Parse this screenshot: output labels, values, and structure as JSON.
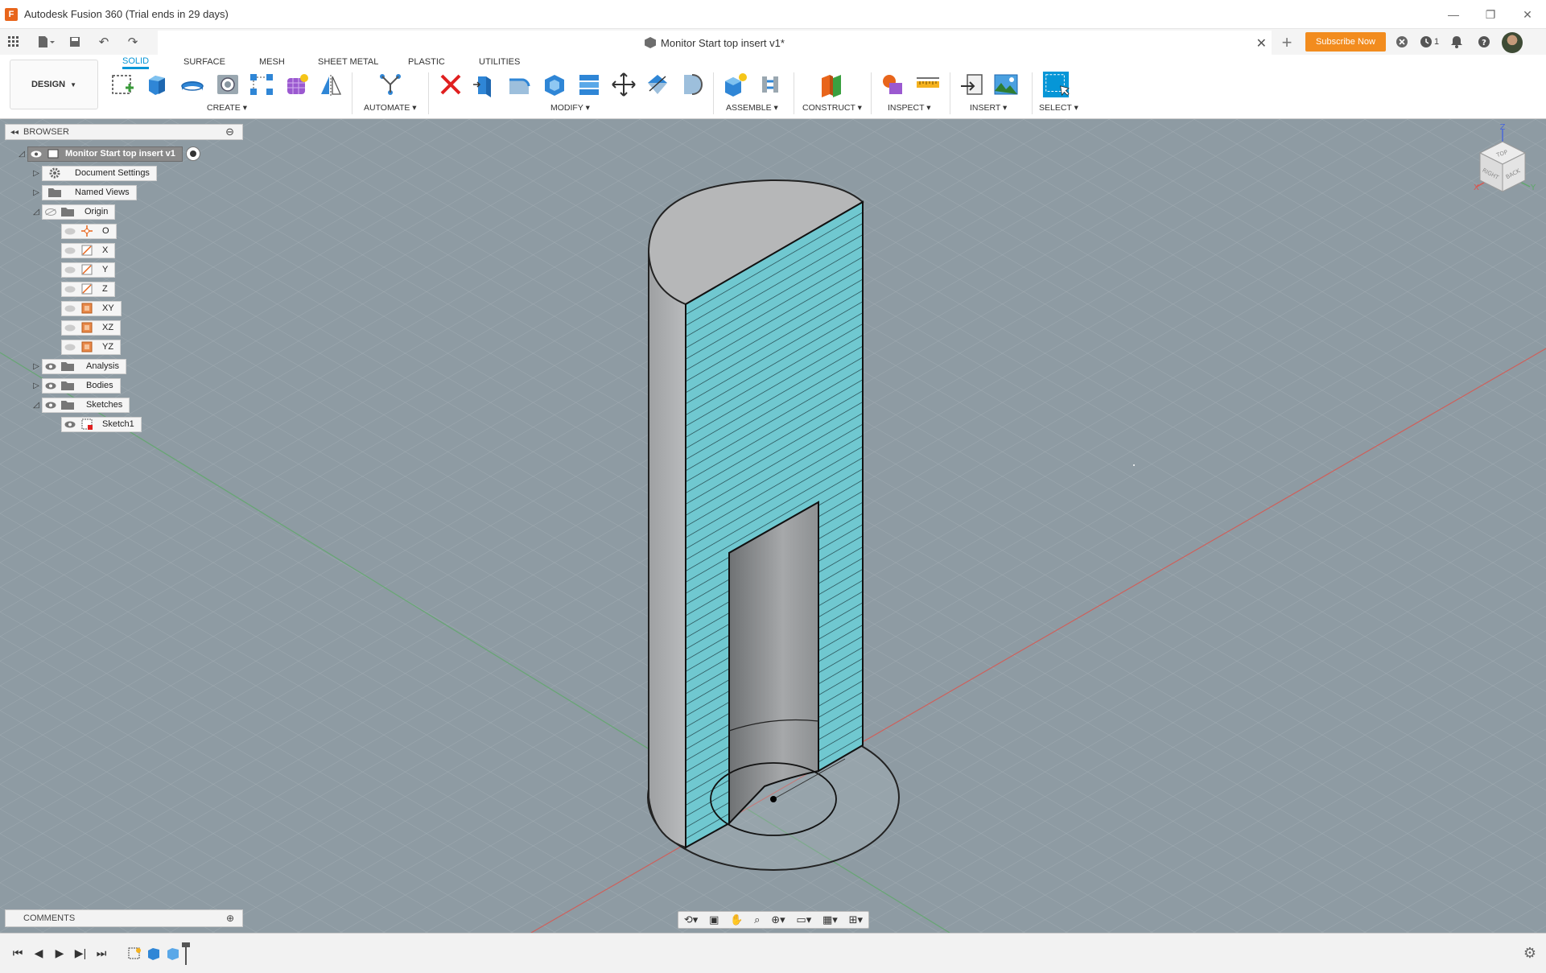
{
  "window": {
    "title": "Autodesk Fusion 360 (Trial ends in 29 days)",
    "controls": [
      "minimize",
      "restore",
      "close"
    ]
  },
  "tabbar": {
    "document_title": "Monitor Start top insert v1*",
    "subscribe_label": "Subscribe Now",
    "jobs_count": "1"
  },
  "toolbar": {
    "workspace": "DESIGN",
    "mode_tabs": [
      "SOLID",
      "SURFACE",
      "MESH",
      "SHEET METAL",
      "PLASTIC",
      "UTILITIES"
    ],
    "active_mode": "SOLID",
    "groups": {
      "create": "CREATE",
      "automate": "AUTOMATE",
      "modify": "MODIFY",
      "assemble": "ASSEMBLE",
      "construct": "CONSTRUCT",
      "inspect": "INSPECT",
      "insert": "INSERT",
      "select": "SELECT"
    }
  },
  "browser": {
    "title": "BROWSER",
    "root": "Monitor Start top insert v1",
    "items": [
      {
        "label": "Document Settings"
      },
      {
        "label": "Named Views"
      },
      {
        "label": "Origin"
      },
      {
        "label": "O"
      },
      {
        "label": "X"
      },
      {
        "label": "Y"
      },
      {
        "label": "Z"
      },
      {
        "label": "XY"
      },
      {
        "label": "XZ"
      },
      {
        "label": "YZ"
      },
      {
        "label": "Analysis"
      },
      {
        "label": "Bodies"
      },
      {
        "label": "Sketches"
      },
      {
        "label": "Sketch1"
      }
    ]
  },
  "comments": {
    "title": "COMMENTS"
  },
  "viewcube": {
    "faces": [
      "TOP",
      "RIGHT",
      "BACK"
    ],
    "axes": [
      "Z",
      "X",
      "Y"
    ]
  },
  "colors": {
    "accent": "#0696d7",
    "subscribe": "#f28c1e",
    "viewport_bg": "#8e9ba3",
    "section_fill": "#6fc6cf",
    "body_gray": "#a8a8a8"
  }
}
